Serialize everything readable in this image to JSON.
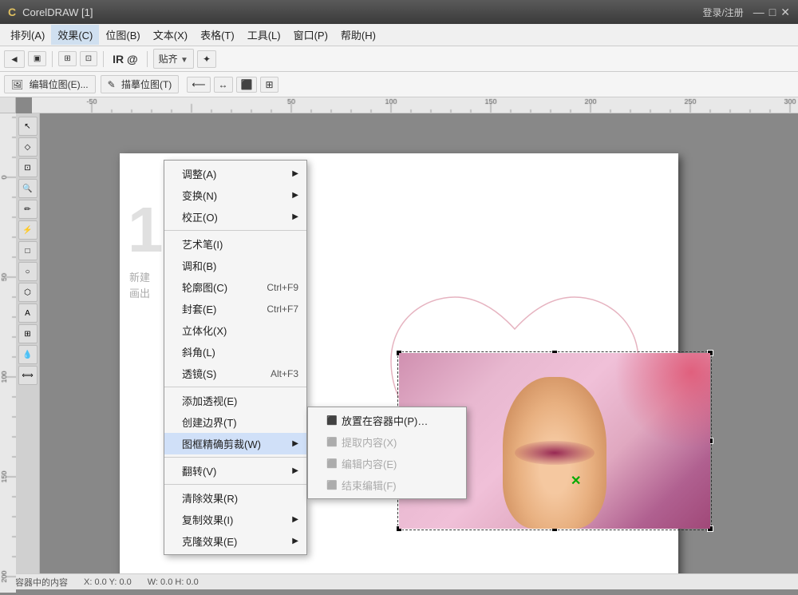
{
  "app": {
    "title": "CorelDRAW [1]",
    "title_short": "CorelDRAW"
  },
  "titlebar": {
    "buttons": {
      "minimize": "—",
      "maximize": "□",
      "close": "✕"
    },
    "login_area": "登录/注册"
  },
  "menubar": {
    "items": [
      {
        "id": "sort",
        "label": "排列(A)"
      },
      {
        "id": "effects",
        "label": "效果(C)",
        "active": true
      },
      {
        "id": "bitmap",
        "label": "位图(B)"
      },
      {
        "id": "text",
        "label": "文本(X)"
      },
      {
        "id": "table",
        "label": "表格(T)"
      },
      {
        "id": "tools",
        "label": "工具(L)"
      },
      {
        "id": "window",
        "label": "窗口(P)"
      },
      {
        "id": "help",
        "label": "帮助(H)"
      }
    ]
  },
  "toolbar": {
    "ir_at_label": "IR @",
    "fit_label": "贴齐",
    "snap_icon": "✦"
  },
  "toolbar2": {
    "edit_bitmap_label": "编辑位图(E)...",
    "trace_bitmap_label": "描摹位图(T)"
  },
  "effects_menu": {
    "items": [
      {
        "id": "adjust",
        "label": "调整(A)",
        "has_submenu": true
      },
      {
        "id": "transform",
        "label": "变换(N)",
        "has_submenu": true
      },
      {
        "id": "correct",
        "label": "校正(O)",
        "has_submenu": true
      },
      {
        "id": "sep1",
        "type": "separator"
      },
      {
        "id": "art_brush",
        "label": "艺术笔(I)"
      },
      {
        "id": "blend",
        "label": "调和(B)"
      },
      {
        "id": "contour",
        "label": "轮廓图(C)",
        "shortcut": "Ctrl+F9"
      },
      {
        "id": "envelope",
        "label": "封套(E)",
        "shortcut": "Ctrl+F7"
      },
      {
        "id": "extrude",
        "label": "立体化(X)"
      },
      {
        "id": "bevel",
        "label": "斜角(L)"
      },
      {
        "id": "lens",
        "label": "透镜(S)",
        "shortcut": "Alt+F3"
      },
      {
        "id": "sep2",
        "type": "separator"
      },
      {
        "id": "add_perspective",
        "label": "添加透视(E)"
      },
      {
        "id": "create_boundary",
        "label": "创建边界(T)"
      },
      {
        "id": "frame_clip",
        "label": "图框精确剪裁(W)",
        "has_submenu": true,
        "active": true
      },
      {
        "id": "sep3",
        "type": "separator"
      },
      {
        "id": "rollover",
        "label": "翻转(V)",
        "has_submenu": true
      },
      {
        "id": "sep4",
        "type": "separator"
      },
      {
        "id": "clear_effects",
        "label": "清除效果(R)"
      },
      {
        "id": "copy_effects",
        "label": "复制效果(I)",
        "has_submenu": true
      },
      {
        "id": "clone_effects",
        "label": "克隆效果(E)",
        "has_submenu": true
      }
    ]
  },
  "frame_clip_submenu": {
    "items": [
      {
        "id": "place_in_container",
        "label": "放置在容器中(P)…",
        "has_icon": true
      },
      {
        "id": "extract_content",
        "label": "提取内容(X)",
        "has_icon": true,
        "disabled": true
      },
      {
        "id": "edit_content",
        "label": "编辑内容(E)",
        "has_icon": true,
        "disabled": true
      },
      {
        "id": "finish_edit",
        "label": "结束编辑(F)",
        "has_icon": true,
        "disabled": true
      }
    ]
  },
  "canvas": {
    "page_number": "1",
    "new_label": "新建",
    "draw_label": "画出"
  },
  "status_bar": {
    "info": "在容器中的内容",
    "coords": "X: 0.0  Y: 0.0",
    "size": "W: 0.0  H: 0.0"
  }
}
